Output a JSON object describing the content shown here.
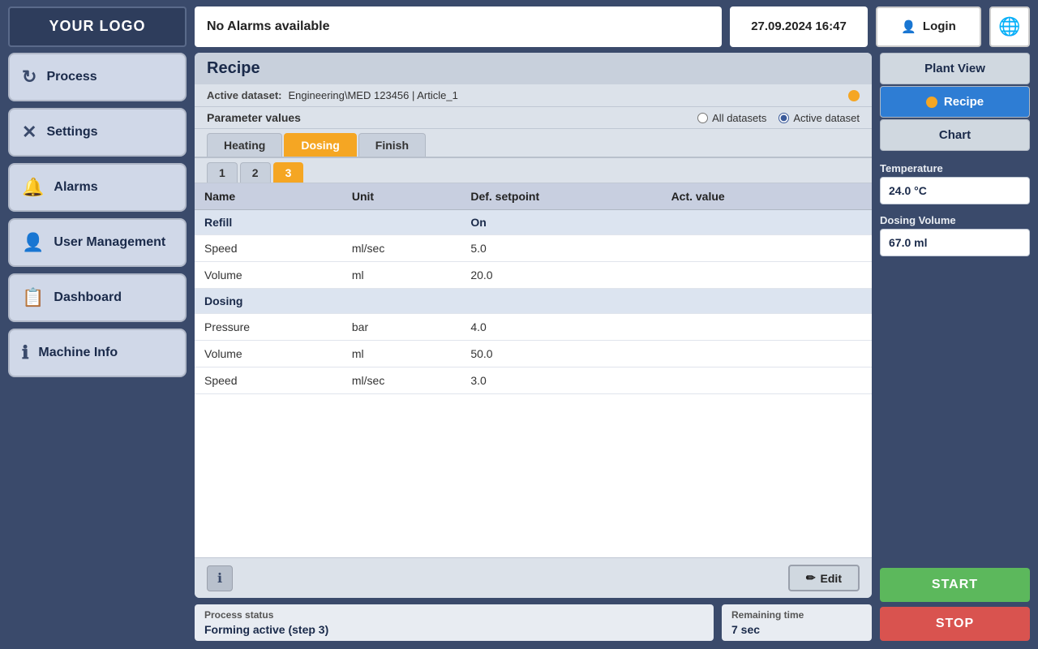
{
  "topbar": {
    "logo": "YOUR LOGO",
    "alarm_text": "No Alarms available",
    "datetime": "27.09.2024 16:47",
    "login_label": "Login",
    "globe_icon": "🌐"
  },
  "sidebar": {
    "items": [
      {
        "id": "process",
        "label": "Process",
        "icon": "↻"
      },
      {
        "id": "settings",
        "label": "Settings",
        "icon": "✕"
      },
      {
        "id": "alarms",
        "label": "Alarms",
        "icon": "🔔"
      },
      {
        "id": "user-management",
        "label": "User Management",
        "icon": "👤"
      },
      {
        "id": "dashboard",
        "label": "Dashboard",
        "icon": "📋"
      },
      {
        "id": "machine-info",
        "label": "Machine Info",
        "icon": "ℹ"
      }
    ]
  },
  "recipe": {
    "title": "Recipe",
    "active_dataset_label": "Active dataset:",
    "active_dataset_value": "Engineering\\MED 123456 | Article_1",
    "param_values_label": "Parameter values",
    "all_datasets_label": "All datasets",
    "active_dataset_radio_label": "Active dataset",
    "tabs": [
      {
        "id": "heating",
        "label": "Heating"
      },
      {
        "id": "dosing",
        "label": "Dosing",
        "active": true
      },
      {
        "id": "finish",
        "label": "Finish"
      }
    ],
    "sub_tabs": [
      {
        "id": "1",
        "label": "1"
      },
      {
        "id": "2",
        "label": "2"
      },
      {
        "id": "3",
        "label": "3",
        "active": true
      }
    ],
    "table": {
      "headers": [
        "Name",
        "Unit",
        "Def. setpoint",
        "Act. value"
      ],
      "groups": [
        {
          "group_name": "Refill",
          "group_extra": "On",
          "rows": [
            {
              "name": "Speed",
              "unit": "ml/sec",
              "def_setpoint": "5.0",
              "act_value": ""
            },
            {
              "name": "Volume",
              "unit": "ml",
              "def_setpoint": "20.0",
              "act_value": ""
            }
          ]
        },
        {
          "group_name": "Dosing",
          "group_extra": "",
          "rows": [
            {
              "name": "Pressure",
              "unit": "bar",
              "def_setpoint": "4.0",
              "act_value": ""
            },
            {
              "name": "Volume",
              "unit": "ml",
              "def_setpoint": "50.0",
              "act_value": ""
            },
            {
              "name": "Speed",
              "unit": "ml/sec",
              "def_setpoint": "3.0",
              "act_value": ""
            }
          ]
        }
      ]
    },
    "edit_label": "Edit",
    "info_icon": "ℹ"
  },
  "status": {
    "process_status_label": "Process status",
    "process_status_value": "Forming active (step 3)",
    "remaining_time_label": "Remaining time",
    "remaining_time_value": "7 sec"
  },
  "right_panel": {
    "nav_items": [
      {
        "id": "plant-view",
        "label": "Plant View",
        "active": false
      },
      {
        "id": "recipe",
        "label": "Recipe",
        "active": true
      },
      {
        "id": "chart",
        "label": "Chart",
        "active": false
      }
    ],
    "temperature_label": "Temperature",
    "temperature_value": "24.0 °C",
    "dosing_volume_label": "Dosing Volume",
    "dosing_volume_value": "67.0 ml",
    "start_label": "START",
    "stop_label": "STOP"
  }
}
